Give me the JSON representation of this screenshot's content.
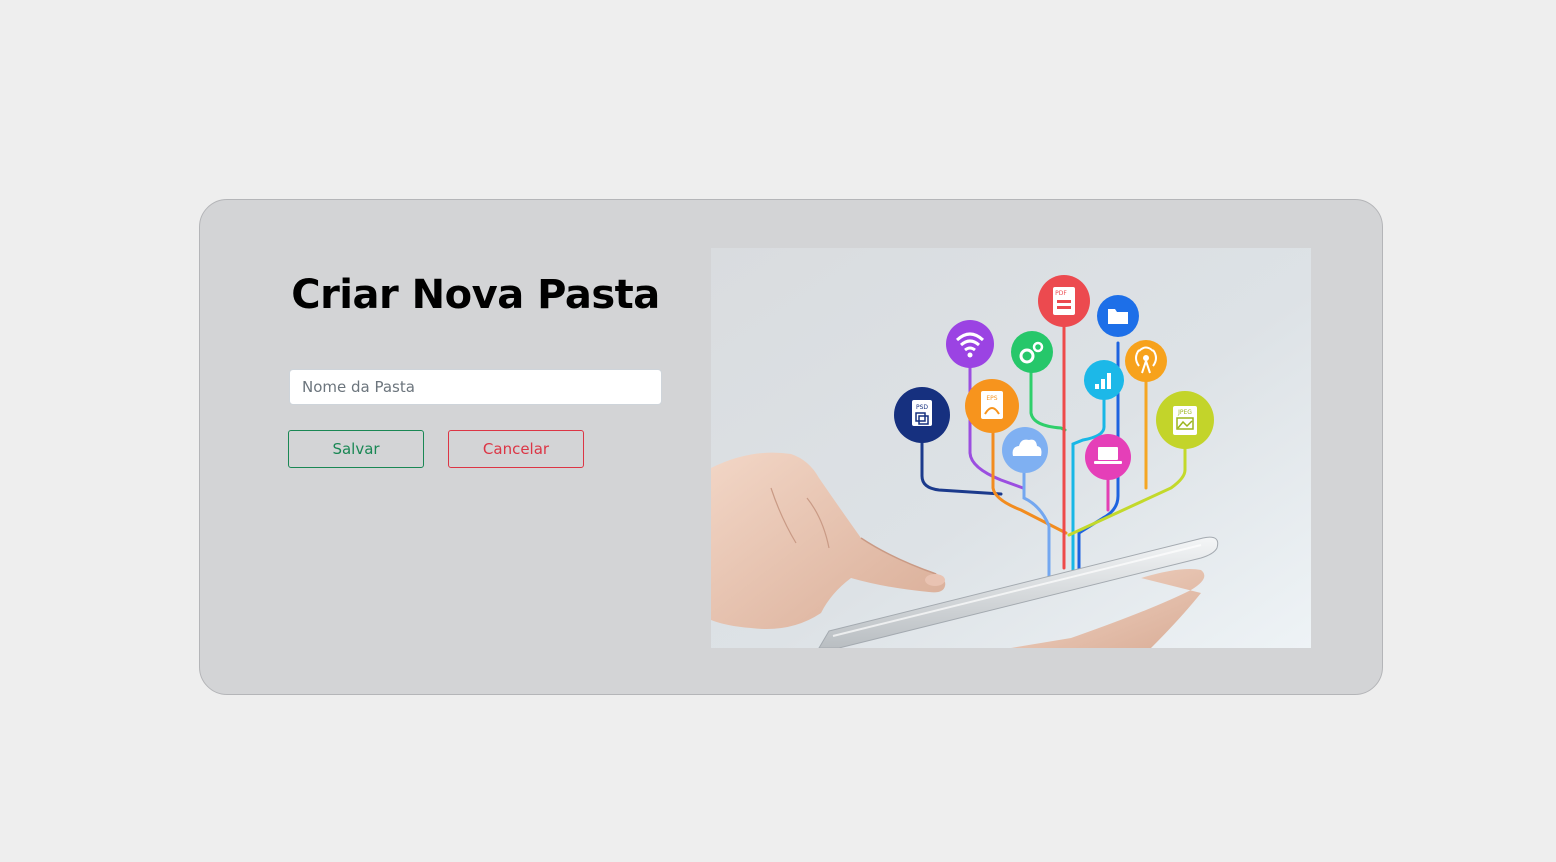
{
  "form": {
    "title": "Criar Nova Pasta",
    "name_placeholder": "Nome da Pasta",
    "name_value": "",
    "save_label": "Salvar",
    "cancel_label": "Cancelar"
  },
  "colors": {
    "page_background": "#eeeeee",
    "card_background": "#d3d4d6",
    "save": "#198754",
    "cancel": "#dc3545"
  },
  "illustration": {
    "description_icons": [
      "psd-file-icon",
      "wifi-icon",
      "ai-file-icon",
      "gears-icon",
      "cloud-icon",
      "pdf-file-icon",
      "bar-chart-icon",
      "folder-icon",
      "laptop-icon",
      "antenna-icon",
      "jpeg-file-icon"
    ],
    "file_labels": {
      "psd": "PSD",
      "eps": "EPS",
      "pdf": "PDF",
      "jpeg": "JPEG"
    }
  }
}
